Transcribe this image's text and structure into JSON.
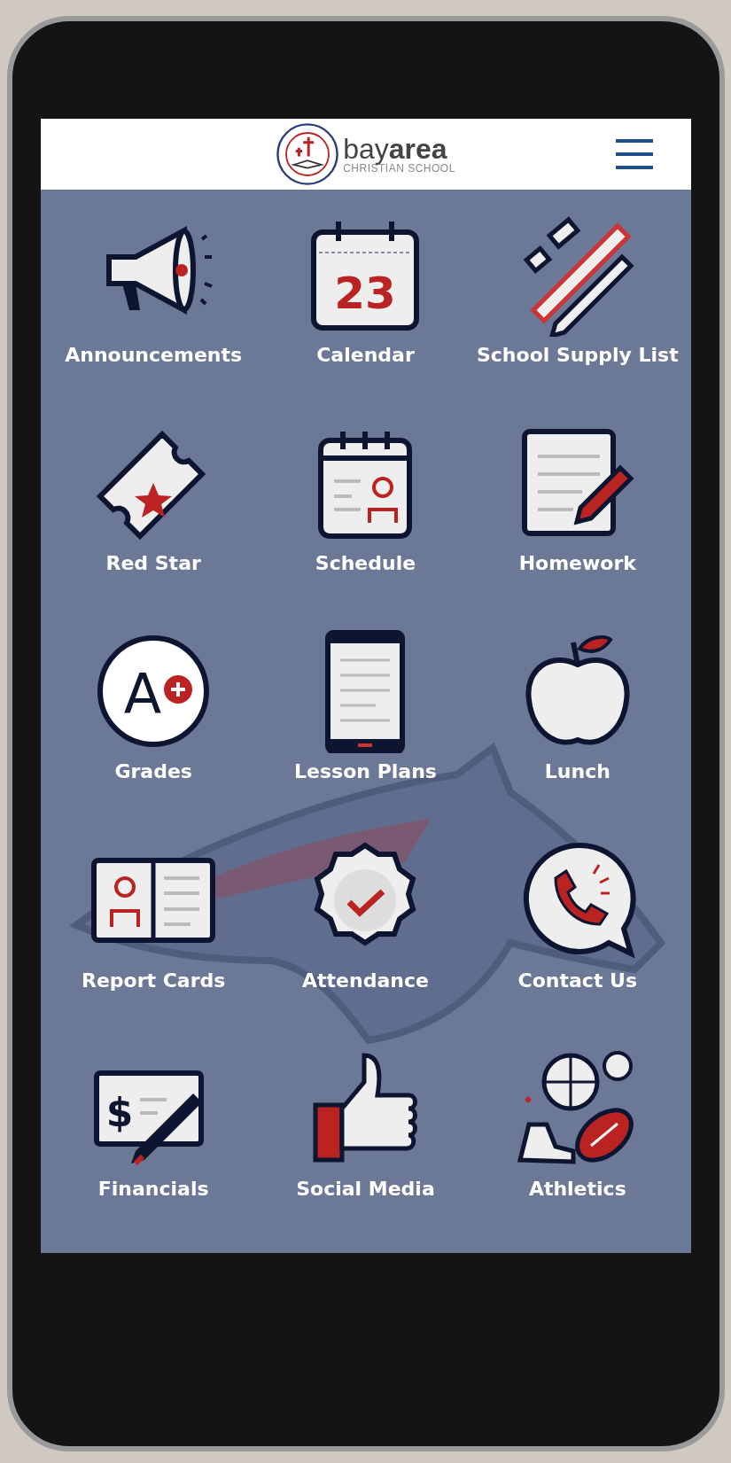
{
  "header": {
    "logo_text": "bay**area**",
    "logo_subtitle": "CHRISTIAN SCHOOL"
  },
  "tiles": [
    {
      "label": "Announcements",
      "kind": "megaphone"
    },
    {
      "label": "Calendar",
      "kind": "calendar",
      "badge": "23"
    },
    {
      "label": "School Supply List",
      "kind": "supplies"
    },
    {
      "label": "Red Star",
      "kind": "ticket"
    },
    {
      "label": "Schedule",
      "kind": "schedule"
    },
    {
      "label": "Homework",
      "kind": "homework"
    },
    {
      "label": "Grades",
      "kind": "grade",
      "badge": "A"
    },
    {
      "label": "Lesson Plans",
      "kind": "tablet"
    },
    {
      "label": "Lunch",
      "kind": "apple"
    },
    {
      "label": "Report Cards",
      "kind": "report"
    },
    {
      "label": "Attendance",
      "kind": "check"
    },
    {
      "label": "Contact Us",
      "kind": "phone"
    },
    {
      "label": "Financials",
      "kind": "cheque",
      "badge": "$"
    },
    {
      "label": "Social Media",
      "kind": "thumb"
    },
    {
      "label": "Athletics",
      "kind": "balls"
    }
  ]
}
